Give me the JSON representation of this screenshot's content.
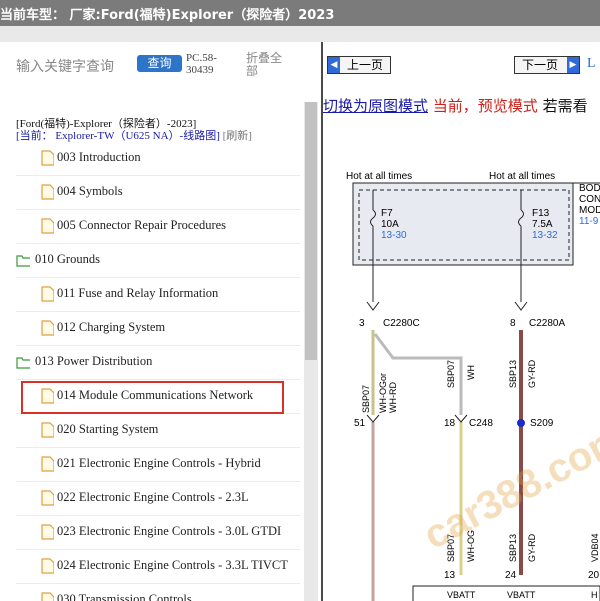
{
  "titlebar": {
    "text": "当前车型：  厂家:Ford(福特)Explorer（探险者）2023"
  },
  "left": {
    "search_placeholder": "输入关键字查询",
    "query_label": "查询",
    "pc_code": "PC.58-\n30439",
    "collapse_label": "折叠全\n部",
    "vehicle": "[Ford(福特)-Explorer（探险者）-2023]",
    "current_prefix": "[当前：",
    "current_link": "Explorer-TW（U625 NA）-线路图]",
    "refresh": "[刷新]",
    "tree": [
      {
        "type": "file",
        "label": "003 Introduction"
      },
      {
        "type": "file",
        "label": "004 Symbols"
      },
      {
        "type": "file",
        "label": "005 Connector Repair Procedures"
      },
      {
        "type": "folder",
        "label": "010 Grounds"
      },
      {
        "type": "file",
        "label": "011 Fuse and Relay Information"
      },
      {
        "type": "file",
        "label": "012 Charging System"
      },
      {
        "type": "folder",
        "label": "013 Power Distribution"
      },
      {
        "type": "file",
        "label": "014 Module Communications Network"
      },
      {
        "type": "file",
        "label": "020 Starting System"
      },
      {
        "type": "file",
        "label": "021 Electronic Engine Controls - Hybrid"
      },
      {
        "type": "file",
        "label": "022 Electronic Engine Controls - 2.3L"
      },
      {
        "type": "file",
        "label": "023 Electronic Engine Controls - 3.0L GTDI"
      },
      {
        "type": "file",
        "label": "024 Electronic Engine Controls - 3.3L TIVCT"
      },
      {
        "type": "file",
        "label": "030 Transmission Controls"
      }
    ]
  },
  "right": {
    "prev_label": "上一页",
    "next_label": "下一页",
    "trailing_char": "L",
    "mode_original": "切换为原图模式",
    "mode_current": "当前，预览模式",
    "mode_need": "若需看",
    "diagram": {
      "hot1": "Hot at all times",
      "hot2": "Hot at all times",
      "body_lines": [
        "BOD",
        "CON",
        "MOD",
        "11-9"
      ],
      "f7": "F7",
      "f7_amp": "10A",
      "f7_ref": "13-30",
      "f13": "F13",
      "f13_amp": "7.5A",
      "f13_ref": "13-32",
      "pin3": "3",
      "c2280c": "C2280C",
      "pin8": "8",
      "c2280a": "C2280A",
      "sbp07a": "SBP07",
      "wh_ogor": "WH-OGor",
      "wh_rd": "WH-RD",
      "sbp07b": "SBP07",
      "wh": "WH",
      "sbp13": "SBP13",
      "gy_rd": "GY-RD",
      "pin51": "51",
      "pin18": "18",
      "c248": "C248",
      "s209": "S209",
      "sbp07c": "SBP07",
      "wh_og": "WH-OG",
      "sbp13b": "SBP13",
      "gy_rd2": "GY-RD",
      "vdb04": "VDB04",
      "pin13": "13",
      "pin24": "24",
      "pin20": "20",
      "vbatt1": "VBATT",
      "vbatt2": "VBATT",
      "h1": "H",
      "h2": "H",
      "watermark": "car388.com"
    }
  },
  "colors": {
    "accent": "#2e74c8",
    "highlight": "#d9302a",
    "link": "#1a1aa8",
    "warn": "#d0201a"
  }
}
